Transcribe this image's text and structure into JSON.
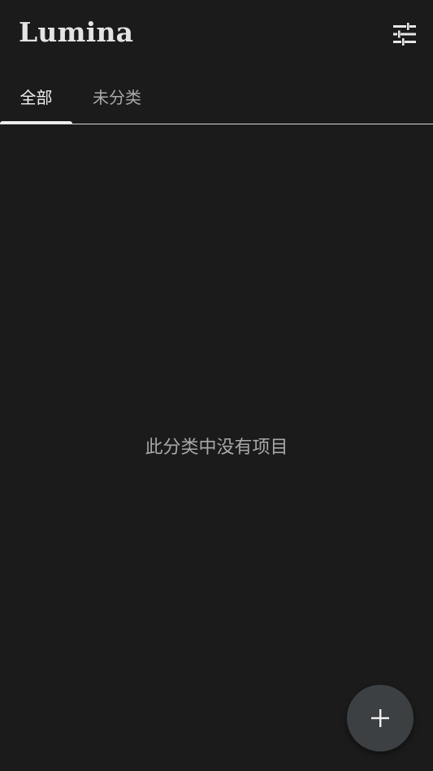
{
  "app_bar": {
    "title": "Lumina",
    "filter_icon": "tune-sliders-icon"
  },
  "tabs": [
    {
      "label": "全部",
      "selected": true
    },
    {
      "label": "未分类",
      "selected": false
    }
  ],
  "main": {
    "empty_message": "此分类中没有项目"
  },
  "fab": {
    "icon": "plus-icon"
  },
  "colors": {
    "background": "#1b1b1b",
    "fab_background": "#3c4043",
    "tab_selected": "#f2f2f2",
    "tab_unselected": "#a9a9a9"
  }
}
